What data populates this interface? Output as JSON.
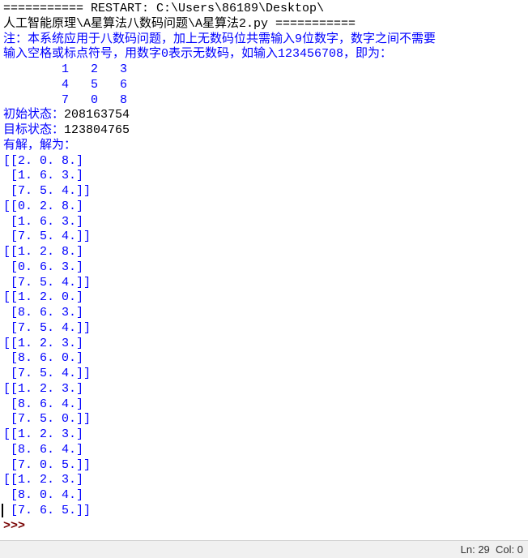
{
  "restart_line": "=========== RESTART: C:\\Users\\86189\\Desktop\\人工智能原理\\A星算法八数码问题\\A星算法2.py ===========",
  "note_lines": [
    "注：本系统应用于八数码问题，加上无数码位共需输入9位数字，数字之间不需要输入空格或标点符号，用数字0表示无数码，如输入123456708，即为：",
    "        1   2   3",
    "        4   5   6",
    "        7   0   8"
  ],
  "prompts": {
    "initial_label": "初始状态：",
    "initial_value": "208163754",
    "target_label": "目标状态：",
    "target_value": "123804765"
  },
  "solution_header": "有解，解为：",
  "solution_matrices": [
    [
      [
        "2.",
        "0.",
        "8."
      ],
      [
        "1.",
        "6.",
        "3."
      ],
      [
        "7.",
        "5.",
        "4."
      ]
    ],
    [
      [
        "0.",
        "2.",
        "8."
      ],
      [
        "1.",
        "6.",
        "3."
      ],
      [
        "7.",
        "5.",
        "4."
      ]
    ],
    [
      [
        "1.",
        "2.",
        "8."
      ],
      [
        "0.",
        "6.",
        "3."
      ],
      [
        "7.",
        "5.",
        "4."
      ]
    ],
    [
      [
        "1.",
        "2.",
        "0."
      ],
      [
        "8.",
        "6.",
        "3."
      ],
      [
        "7.",
        "5.",
        "4."
      ]
    ],
    [
      [
        "1.",
        "2.",
        "3."
      ],
      [
        "8.",
        "6.",
        "0."
      ],
      [
        "7.",
        "5.",
        "4."
      ]
    ],
    [
      [
        "1.",
        "2.",
        "3."
      ],
      [
        "8.",
        "6.",
        "4."
      ],
      [
        "7.",
        "5.",
        "0."
      ]
    ],
    [
      [
        "1.",
        "2.",
        "3."
      ],
      [
        "8.",
        "6.",
        "4."
      ],
      [
        "7.",
        "0.",
        "5."
      ]
    ],
    [
      [
        "1.",
        "2.",
        "3."
      ],
      [
        "8.",
        "0.",
        "4."
      ],
      [
        "7.",
        "6.",
        "5."
      ]
    ]
  ],
  "cursor_row_index": 23,
  "prompt_symbol": ">>> ",
  "status": {
    "ln": "Ln: 29",
    "col": "Col: 0"
  }
}
